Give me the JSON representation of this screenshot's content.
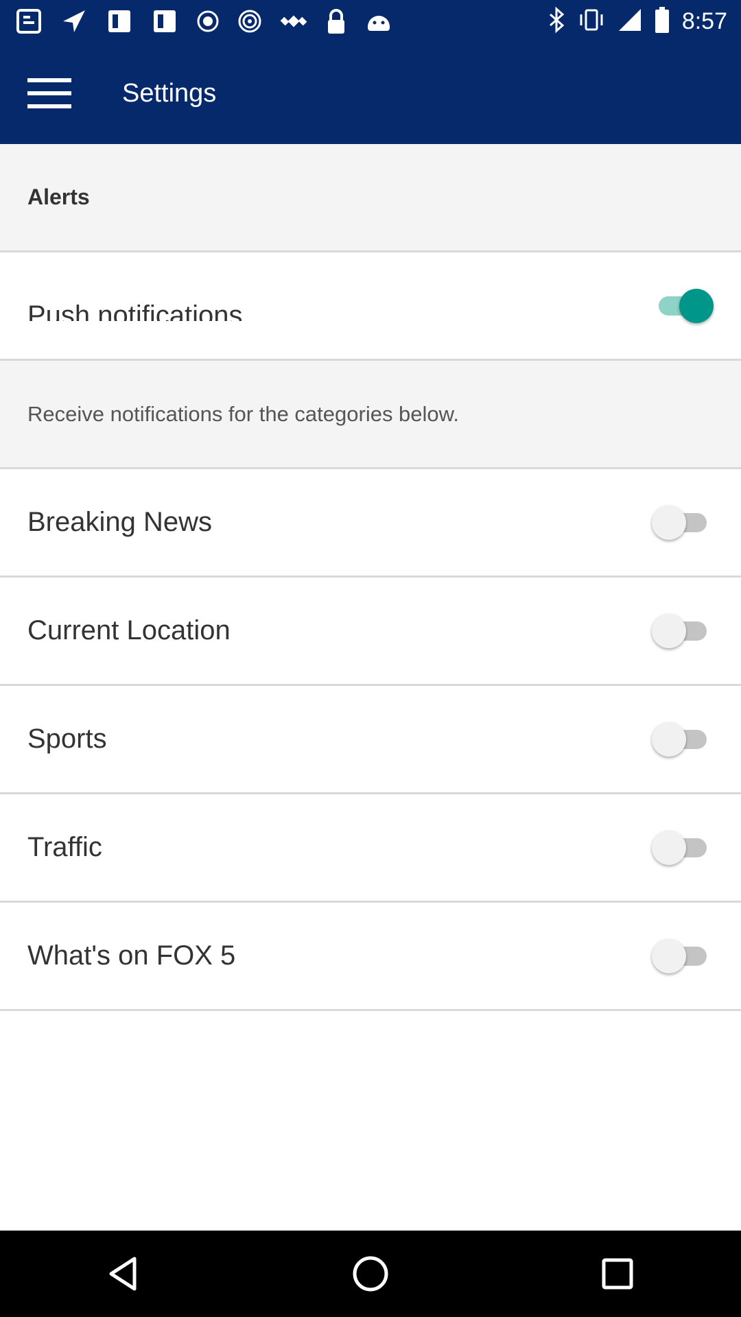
{
  "status_bar": {
    "time": "8:57",
    "icons": [
      "notification-app-icon",
      "navigation-arrow-icon",
      "notification-app-icon",
      "notification-app-icon",
      "record-icon",
      "wifi-hotspot-icon",
      "satellite-icon",
      "lock-icon",
      "android-icon",
      "bluetooth-icon",
      "vibrate-icon",
      "signal-icon",
      "battery-icon"
    ]
  },
  "app_bar": {
    "title": "Settings",
    "menu_icon": "hamburger-menu-icon",
    "background_color": "#05296b"
  },
  "settings": {
    "section_header": "Alerts",
    "push_notifications": {
      "label": "Push notifications",
      "enabled": true
    },
    "description": "Receive notifications for the categories below.",
    "categories": [
      {
        "label": "Breaking News",
        "enabled": false
      },
      {
        "label": "Current Location",
        "enabled": false
      },
      {
        "label": "Sports",
        "enabled": false
      },
      {
        "label": "Traffic",
        "enabled": false
      },
      {
        "label": "What's on FOX 5",
        "enabled": false
      }
    ],
    "toggle_on_color": "#009689"
  },
  "nav_bar": {
    "buttons": [
      "back-icon",
      "home-icon",
      "recents-icon"
    ]
  }
}
